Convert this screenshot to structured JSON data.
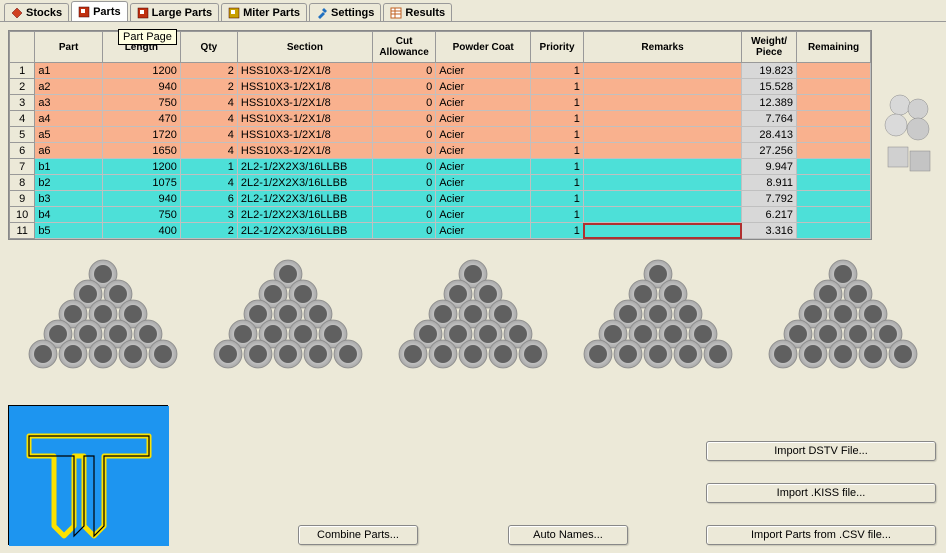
{
  "tooltip": "Part Page",
  "tabs": [
    {
      "label": "Stocks",
      "icon": "diamond",
      "color": "#d04020"
    },
    {
      "label": "Parts",
      "icon": "square",
      "color": "#c03010",
      "active": true
    },
    {
      "label": "Large Parts",
      "icon": "square",
      "color": "#c03010"
    },
    {
      "label": "Miter Parts",
      "icon": "square",
      "color": "#c8a000"
    },
    {
      "label": "Settings",
      "icon": "wrench",
      "color": "#2070c0"
    },
    {
      "label": "Results",
      "icon": "grid",
      "color": "#c06020"
    }
  ],
  "headers": {
    "part": "Part",
    "length": "Length",
    "qty": "Qty",
    "section": "Section",
    "cut_allowance": "Cut Allowance",
    "powder_coat": "Powder Coat",
    "priority": "Priority",
    "remarks": "Remarks",
    "weight_piece": "Weight/ Piece",
    "remaining": "Remaining"
  },
  "rows": [
    {
      "n": "1",
      "part": "a1",
      "len": "1200",
      "qty": "2",
      "section": "HSS10X3-1/2X1/8",
      "cut": "0",
      "coat": "Acier",
      "pri": "1",
      "rem": "",
      "wt": "19.823",
      "grp": "a"
    },
    {
      "n": "2",
      "part": "a2",
      "len": "940",
      "qty": "2",
      "section": "HSS10X3-1/2X1/8",
      "cut": "0",
      "coat": "Acier",
      "pri": "1",
      "rem": "",
      "wt": "15.528",
      "grp": "a"
    },
    {
      "n": "3",
      "part": "a3",
      "len": "750",
      "qty": "4",
      "section": "HSS10X3-1/2X1/8",
      "cut": "0",
      "coat": "Acier",
      "pri": "1",
      "rem": "",
      "wt": "12.389",
      "grp": "a"
    },
    {
      "n": "4",
      "part": "a4",
      "len": "470",
      "qty": "4",
      "section": "HSS10X3-1/2X1/8",
      "cut": "0",
      "coat": "Acier",
      "pri": "1",
      "rem": "",
      "wt": "7.764",
      "grp": "a"
    },
    {
      "n": "5",
      "part": "a5",
      "len": "1720",
      "qty": "4",
      "section": "HSS10X3-1/2X1/8",
      "cut": "0",
      "coat": "Acier",
      "pri": "1",
      "rem": "",
      "wt": "28.413",
      "grp": "a"
    },
    {
      "n": "6",
      "part": "a6",
      "len": "1650",
      "qty": "4",
      "section": "HSS10X3-1/2X1/8",
      "cut": "0",
      "coat": "Acier",
      "pri": "1",
      "rem": "",
      "wt": "27.256",
      "grp": "a"
    },
    {
      "n": "7",
      "part": "b1",
      "len": "1200",
      "qty": "1",
      "section": "2L2-1/2X2X3/16LLBB",
      "cut": "0",
      "coat": "Acier",
      "pri": "1",
      "rem": "",
      "wt": "9.947",
      "grp": "b"
    },
    {
      "n": "8",
      "part": "b2",
      "len": "1075",
      "qty": "4",
      "section": "2L2-1/2X2X3/16LLBB",
      "cut": "0",
      "coat": "Acier",
      "pri": "1",
      "rem": "",
      "wt": "8.911",
      "grp": "b"
    },
    {
      "n": "9",
      "part": "b3",
      "len": "940",
      "qty": "6",
      "section": "2L2-1/2X2X3/16LLBB",
      "cut": "0",
      "coat": "Acier",
      "pri": "1",
      "rem": "",
      "wt": "7.792",
      "grp": "b"
    },
    {
      "n": "10",
      "part": "b4",
      "len": "750",
      "qty": "3",
      "section": "2L2-1/2X2X3/16LLBB",
      "cut": "0",
      "coat": "Acier",
      "pri": "1",
      "rem": "",
      "wt": "6.217",
      "grp": "b"
    },
    {
      "n": "11",
      "part": "b5",
      "len": "400",
      "qty": "2",
      "section": "2L2-1/2X2X3/16LLBB",
      "cut": "0",
      "coat": "Acier",
      "pri": "1",
      "rem": "",
      "wt": "3.316",
      "grp": "b",
      "selected": true
    }
  ],
  "buttons": {
    "combine": "Combine Parts...",
    "auto_names": "Auto Names...",
    "import_dstv": "Import DSTV File...",
    "import_kiss": "Import .KISS file...",
    "import_csv": "Import Parts from .CSV file..."
  }
}
